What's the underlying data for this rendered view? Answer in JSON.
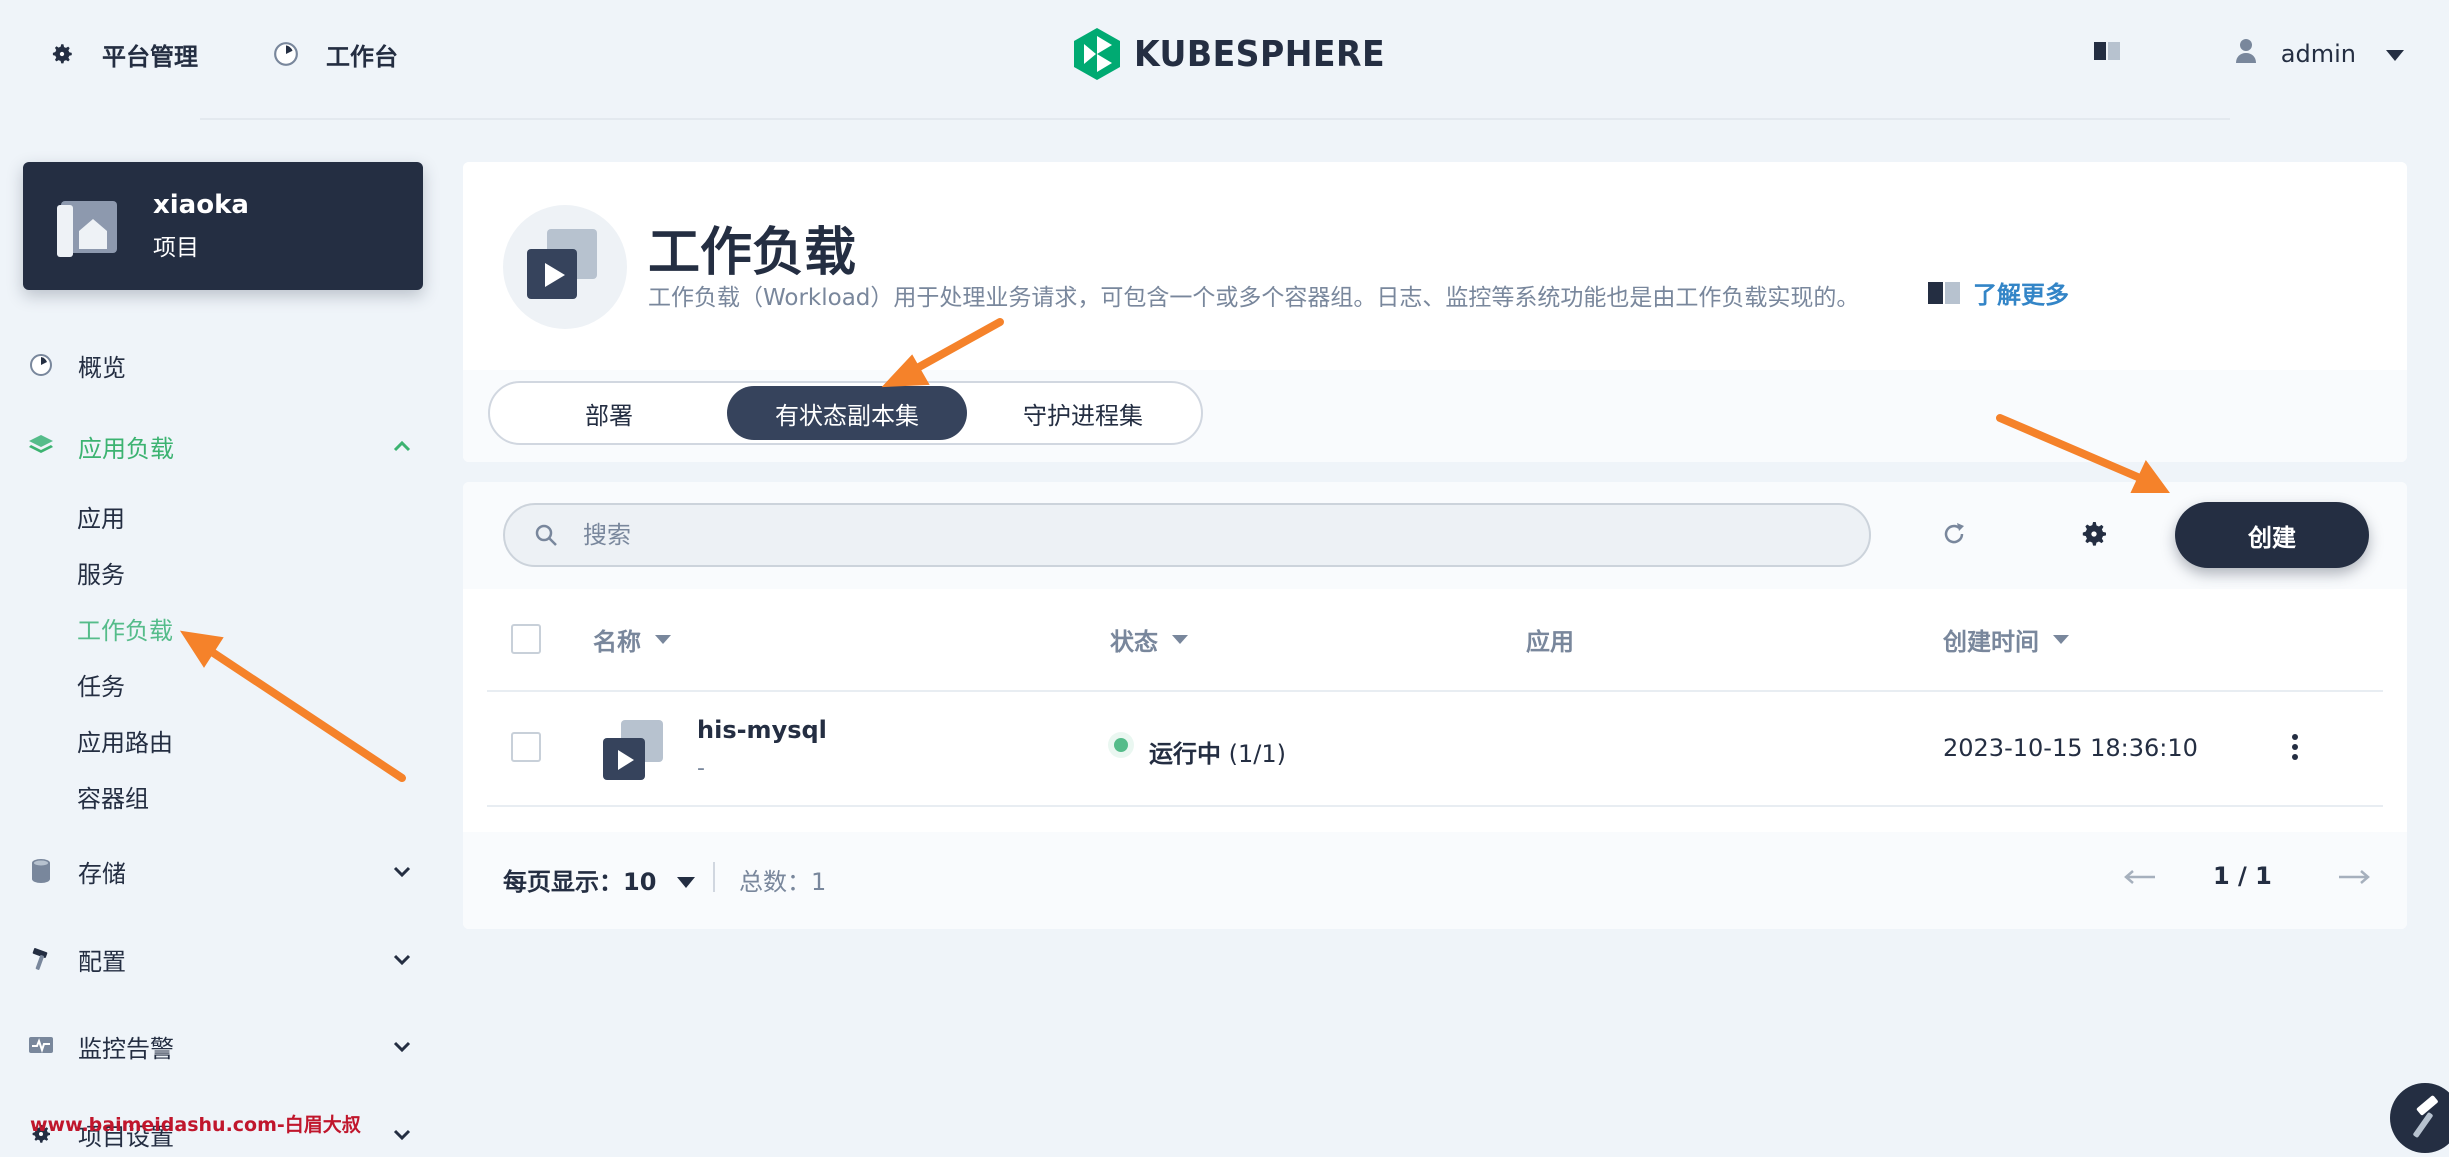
{
  "header": {
    "nav": [
      {
        "label": "平台管理",
        "icon": "gear-icon"
      },
      {
        "label": "工作台",
        "icon": "dashboard-icon"
      }
    ],
    "logo_text": "KUBESPHERE",
    "user": "admin"
  },
  "sidebar": {
    "project_name": "xiaoka",
    "project_type": "项目",
    "items": [
      {
        "label": "概览",
        "icon": "dashboard-icon"
      },
      {
        "label": "应用负载",
        "icon": "layers-icon"
      },
      {
        "label": "存储",
        "icon": "database-icon"
      },
      {
        "label": "配置",
        "icon": "hammer-icon"
      },
      {
        "label": "监控告警",
        "icon": "monitor-icon"
      },
      {
        "label": "项目设置",
        "icon": "gear-icon"
      }
    ],
    "sub_items": [
      "应用",
      "服务",
      "工作负载",
      "任务",
      "应用路由",
      "容器组"
    ]
  },
  "page": {
    "title": "工作负载",
    "description": "工作负载（Workload）用于处理业务请求，可包含一个或多个容器组。日志、监控等系统功能也是由工作负载实现的。",
    "learn_more": "了解更多",
    "tabs": [
      "部署",
      "有状态副本集",
      "守护进程集"
    ]
  },
  "toolbar": {
    "search_placeholder": "搜索",
    "create_label": "创建"
  },
  "table": {
    "columns": [
      "名称",
      "状态",
      "应用",
      "创建时间"
    ],
    "rows": [
      {
        "name": "his-mysql",
        "sub": "-",
        "status": "运行中",
        "status_count": "(1/1)",
        "app": "",
        "created": "2023-10-15 18:36:10"
      }
    ]
  },
  "pagination": {
    "page_size_label": "每页显示：",
    "page_size": "10",
    "total_label": "总数：",
    "total": "1",
    "page": "1 / 1"
  },
  "watermark": "www.baimeidashu.com-白眉大叔",
  "colors": {
    "dark": "#242e42",
    "accent_green": "#55bc8a",
    "link_blue": "#3385c7",
    "arrow_orange": "#f5822a"
  }
}
